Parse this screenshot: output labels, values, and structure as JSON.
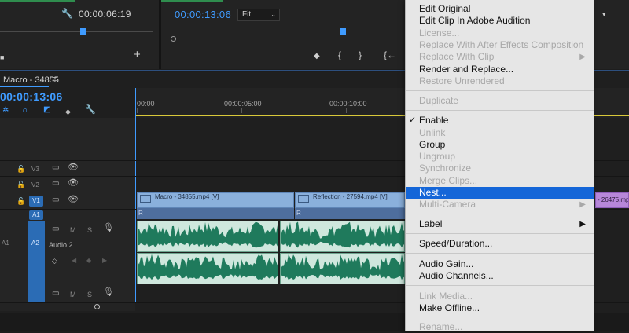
{
  "source_monitor": {
    "timecode": "00:00:06:19",
    "add_symbol": "+",
    "square_symbol": "■"
  },
  "program_monitor": {
    "timecode": "00:00:13:06",
    "zoom": "Fit",
    "right_select_arrow": "▾",
    "ctrl_marker": "◆",
    "ctrl_in": "{",
    "ctrl_out": "}",
    "ctrl_goto_in": "{←"
  },
  "sequence": {
    "tab": "Macro - 34855",
    "menu_symbol": "≡",
    "timecode": "00:00:13:06",
    "ruler": [
      "00:00",
      "00:00:05:00",
      "00:00:10:00"
    ]
  },
  "tracks": {
    "v3": "V3",
    "v2": "V2",
    "v1": "V1",
    "a1_patch": "A1",
    "a1": "A1",
    "a2": "A2",
    "mute": "M",
    "solo": "S",
    "a2_name": "Audio 2"
  },
  "clips": {
    "video1": "Macro - 34855.mp4 [V]",
    "video2": "Reflection - 27594.mp4 [V]",
    "video3": "- 26475.mp4 [V]",
    "r_label": "R",
    "fx_label": "fx"
  },
  "context_menu": {
    "items": [
      {
        "label": "Edit Original",
        "enabled": true
      },
      {
        "label": "Edit Clip In Adobe Audition",
        "enabled": true
      },
      {
        "label": "License...",
        "enabled": false
      },
      {
        "label": "Replace With After Effects Composition",
        "enabled": false
      },
      {
        "label": "Replace With Clip",
        "enabled": false,
        "submenu": true
      },
      {
        "label": "Render and Replace...",
        "enabled": true
      },
      {
        "label": "Restore Unrendered",
        "enabled": false
      },
      {
        "label": "Duplicate",
        "enabled": false
      },
      {
        "label": "Enable",
        "enabled": true,
        "checked": true
      },
      {
        "label": "Unlink",
        "enabled": false
      },
      {
        "label": "Group",
        "enabled": true
      },
      {
        "label": "Ungroup",
        "enabled": false
      },
      {
        "label": "Synchronize",
        "enabled": false
      },
      {
        "label": "Merge Clips...",
        "enabled": false
      },
      {
        "label": "Nest...",
        "enabled": true,
        "highlighted": true
      },
      {
        "label": "Multi-Camera",
        "enabled": false,
        "submenu": true
      },
      {
        "label": "Label",
        "enabled": true,
        "submenu": true
      },
      {
        "label": "Speed/Duration...",
        "enabled": true
      },
      {
        "label": "Audio Gain...",
        "enabled": true
      },
      {
        "label": "Audio Channels...",
        "enabled": true
      },
      {
        "label": "Link Media...",
        "enabled": false
      },
      {
        "label": "Make Offline...",
        "enabled": true
      },
      {
        "label": "Rename...",
        "enabled": false
      }
    ],
    "check_symbol": "✓",
    "submenu_symbol": "▶"
  },
  "colors": {
    "accent_blue": "#3f9bff",
    "menu_highlight": "#1466d8",
    "video_clip": "#8ab0dc",
    "audio_wave": "#1f7a5c",
    "yellow_work_area": "#d9c93a",
    "purple_clip": "#b787d9"
  },
  "icons": [
    "wrench-icon",
    "playhead-icon",
    "snap-icon",
    "link-icon",
    "marker-icon",
    "lock-icon",
    "film-icon",
    "eye-icon",
    "mic-icon",
    "keyframe-icon"
  ]
}
